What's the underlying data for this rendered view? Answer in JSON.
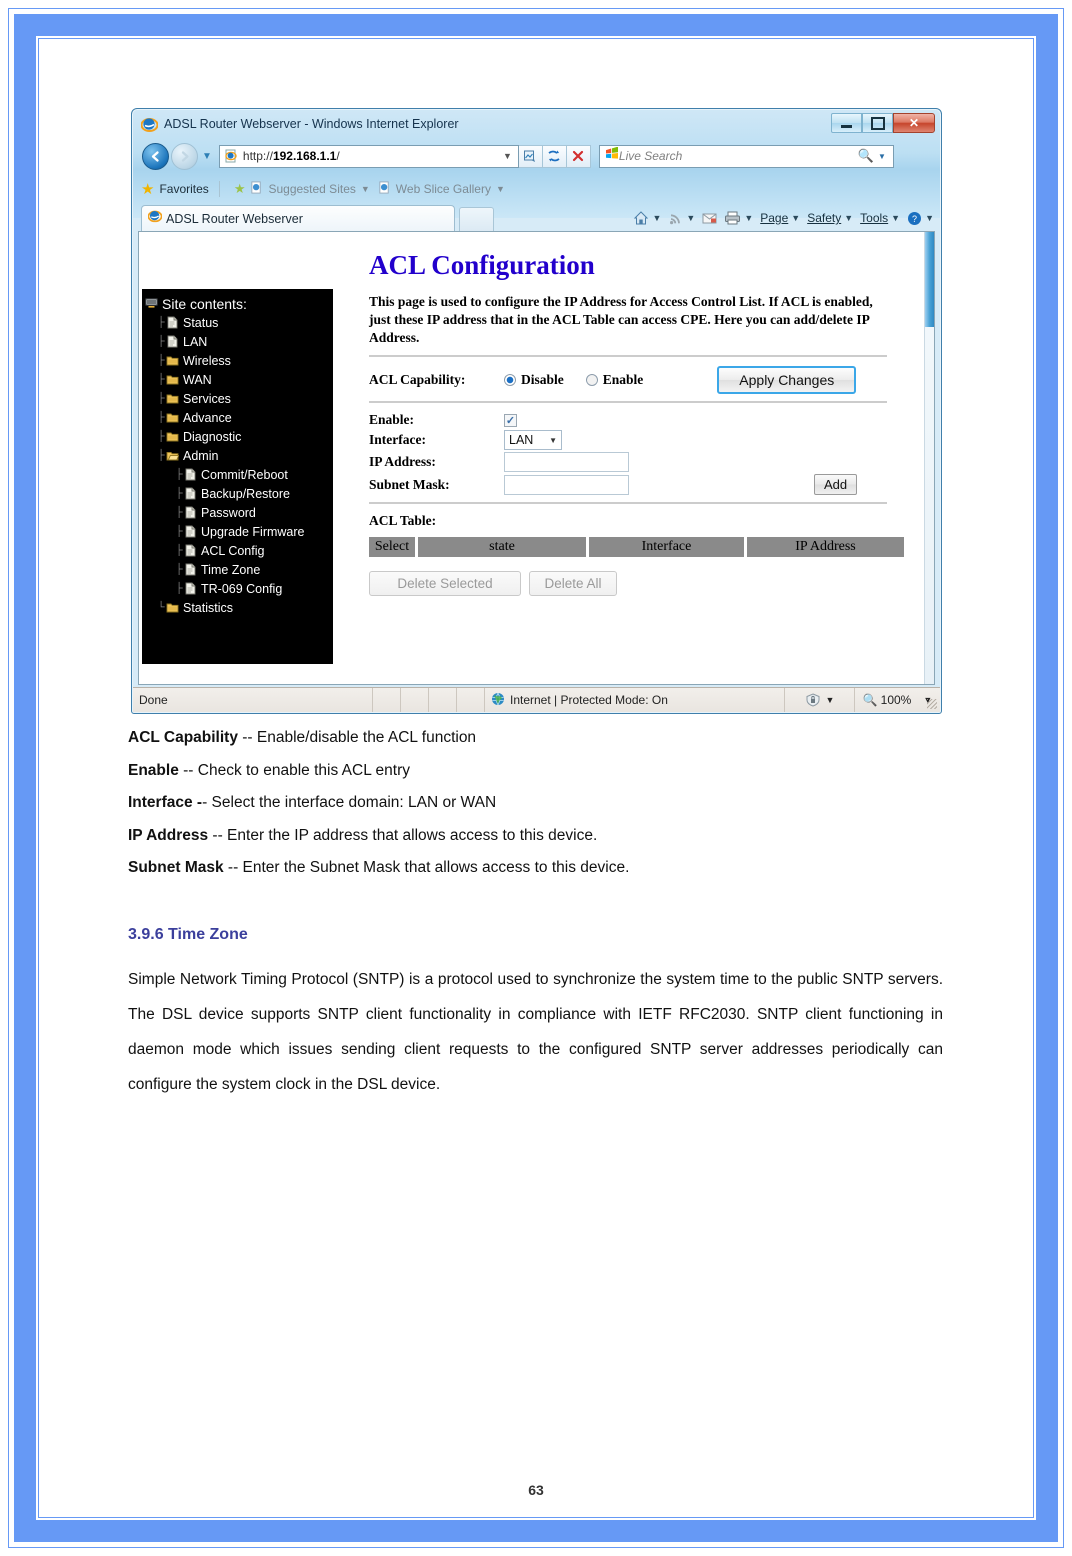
{
  "browser": {
    "title": "ADSL Router Webserver - Windows Internet Explorer",
    "url_prefix": "http://",
    "url_host": "192.168.1.1",
    "url_suffix": "/",
    "search_placeholder": "Live Search",
    "window_buttons": {
      "minimize": "minimize-icon",
      "maximize": "maximize-icon",
      "close": "✕"
    },
    "nav": {
      "back": "◀",
      "forward": "▶",
      "history_caret": "▼"
    },
    "toolbar_icons": [
      "compatibility-view-icon",
      "refresh-icon",
      "stop-icon"
    ],
    "favorites_bar": {
      "favorites": "Favorites",
      "suggested_sites": "Suggested Sites",
      "web_slice_gallery": "Web Slice Gallery"
    },
    "tab": {
      "label": "ADSL Router Webserver"
    },
    "command_bar": {
      "home": "home-icon",
      "feeds": "feeds-icon",
      "mail": "mail-icon",
      "print": "print-icon",
      "page": "Page",
      "safety": "Safety",
      "tools": "Tools",
      "help": "help-icon"
    },
    "status_bar": {
      "status": "Done",
      "zone": "Internet | Protected Mode: On",
      "zoom": "100%"
    }
  },
  "router": {
    "sidebar": {
      "root": "Site contents:",
      "items": [
        {
          "label": "Status",
          "icon": "page-icon",
          "level": 1
        },
        {
          "label": "LAN",
          "icon": "page-icon",
          "level": 1
        },
        {
          "label": "Wireless",
          "icon": "folder-icon",
          "level": 1
        },
        {
          "label": "WAN",
          "icon": "folder-icon",
          "level": 1
        },
        {
          "label": "Services",
          "icon": "folder-icon",
          "level": 1
        },
        {
          "label": "Advance",
          "icon": "folder-icon",
          "level": 1
        },
        {
          "label": "Diagnostic",
          "icon": "folder-icon",
          "level": 1
        },
        {
          "label": "Admin",
          "icon": "folder-open-icon",
          "level": 1
        },
        {
          "label": "Commit/Reboot",
          "icon": "page-icon",
          "level": 2
        },
        {
          "label": "Backup/Restore",
          "icon": "page-icon",
          "level": 2
        },
        {
          "label": "Password",
          "icon": "page-icon",
          "level": 2
        },
        {
          "label": "Upgrade Firmware",
          "icon": "page-icon",
          "level": 2
        },
        {
          "label": "ACL Config",
          "icon": "page-icon",
          "level": 2
        },
        {
          "label": "Time Zone",
          "icon": "page-icon",
          "level": 2
        },
        {
          "label": "TR-069 Config",
          "icon": "page-icon",
          "level": 2
        },
        {
          "label": "Statistics",
          "icon": "folder-icon",
          "level": 1
        }
      ]
    },
    "page": {
      "title": "ACL Configuration",
      "description": "This page is used to configure the IP Address for Access Control List. If ACL is enabled, just these IP address that in the ACL Table can access CPE. Here you can add/delete IP Address.",
      "acl_capability_label": "ACL Capability:",
      "radio_disable": "Disable",
      "radio_enable": "Enable",
      "selected_capability": "Disable",
      "apply_button": "Apply Changes",
      "enable_label": "Enable:",
      "enable_checked": true,
      "enable_check_glyph": "✓",
      "interface_label": "Interface:",
      "interface_value": "LAN",
      "interface_options": [
        "LAN",
        "WAN"
      ],
      "ip_address_label": "IP Address:",
      "ip_address_value": "",
      "subnet_mask_label": "Subnet Mask:",
      "subnet_mask_value": "",
      "add_button": "Add",
      "acl_table_label": "ACL Table:",
      "table_headers": [
        "Select",
        "state",
        "Interface",
        "IP Address"
      ],
      "table_rows": [],
      "delete_selected_button": "Delete Selected",
      "delete_all_button": "Delete All"
    }
  },
  "document": {
    "definitions": [
      {
        "term": "ACL Capability",
        "desc": " -- Enable/disable the ACL function"
      },
      {
        "term": "Enable",
        "desc": " -- Check to enable this ACL entry"
      },
      {
        "term": "Interface -",
        "desc": "- Select the interface domain: LAN or WAN"
      },
      {
        "term": "IP Address",
        "desc": " -- Enter the IP address that allows access to this device."
      },
      {
        "term": "Subnet Mask",
        "desc": " -- Enter the Subnet Mask that allows access to this device."
      }
    ],
    "section_heading": "3.9.6 Time Zone",
    "paragraph": "Simple Network Timing Protocol (SNTP) is a protocol used to synchronize the system time to the public SNTP servers. The DSL device supports SNTP client functionality in compliance with IETF RFC2030. SNTP client functioning in daemon mode which issues sending client requests to the configured SNTP server addresses periodically can configure the system clock in the DSL device.",
    "page_number": "63"
  },
  "colors": {
    "frame_blue": "#6699f5",
    "heading_purple": "#3b3f9c",
    "router_title_blue": "#2200cc",
    "table_header_gray": "#8a8a8a"
  }
}
